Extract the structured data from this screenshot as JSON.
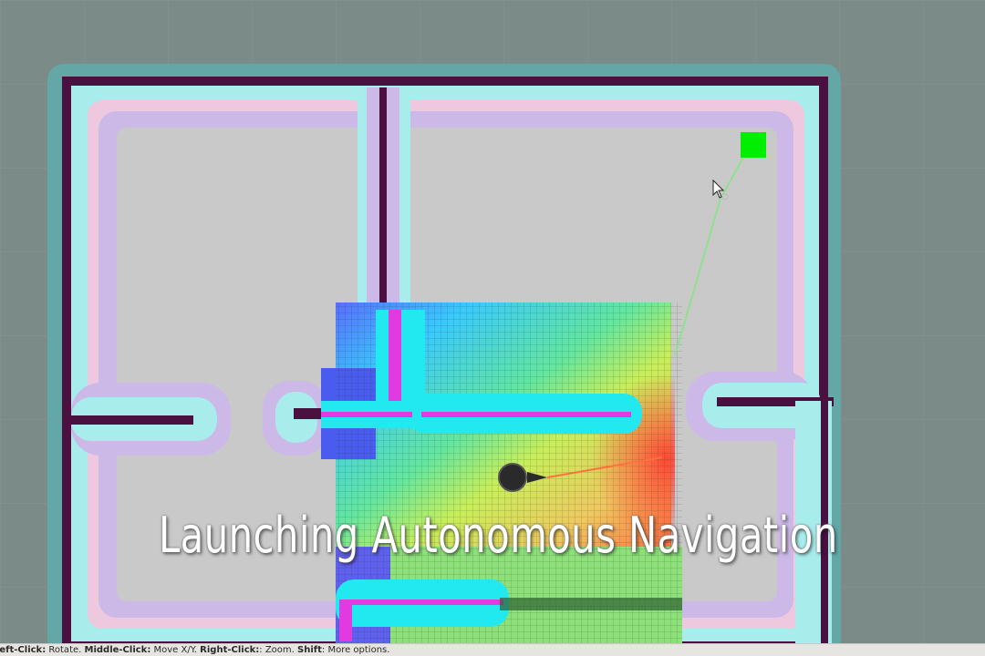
{
  "overlay": {
    "caption": "Launching Autonomous Navigation"
  },
  "status_bar": {
    "parts": [
      {
        "text": "Left-Click:",
        "bold": true
      },
      {
        "text": " Rotate. ",
        "bold": false
      },
      {
        "text": "Middle-Click:",
        "bold": true
      },
      {
        "text": " Move X/Y. ",
        "bold": false
      },
      {
        "text": "Right-Click:",
        "bold": true
      },
      {
        "text": ": Zoom. ",
        "bold": false
      },
      {
        "text": "Shift",
        "bold": true
      },
      {
        "text": ": More options.",
        "bold": false
      }
    ]
  },
  "colors": {
    "background": "#7b8b87",
    "wall": "#4a1040",
    "inflation_outer": "#60a8a8",
    "inflation_inner": "#a8ecec",
    "free_space": "#c8c8c8",
    "goal_marker": "#00ee00",
    "path": "#7fd67f",
    "robot": "#2a2a2a"
  },
  "icons": [
    "mouse-cursor-icon",
    "goal-marker-icon",
    "robot-icon"
  ]
}
